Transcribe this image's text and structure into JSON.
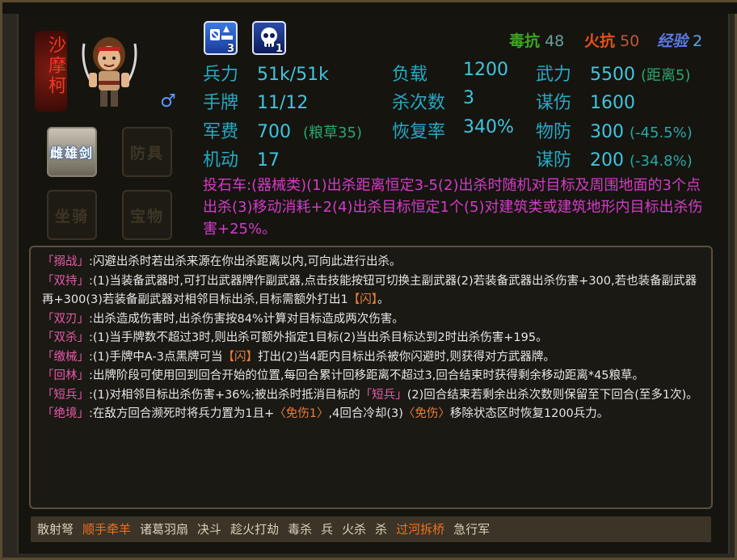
{
  "hero": {
    "name": "沙摩柯",
    "gender_icon": "male-gender-icon"
  },
  "equipment": {
    "weapon": "雌雄剑",
    "armor": "防具",
    "mount": "坐骑",
    "treasure": "宝物"
  },
  "status_icons": [
    {
      "icon": "status-effect-icon",
      "count": "3"
    },
    {
      "icon": "skull-icon",
      "count": "1"
    }
  ],
  "resists": {
    "poison_label": "毒抗",
    "poison_value": "48",
    "fire_label": "火抗",
    "fire_value": "50",
    "exp_label": "经验",
    "exp_value": "2"
  },
  "stats": {
    "troops_label": "兵力",
    "troops_value": "51k/51k",
    "hand_label": "手牌",
    "hand_value": "11/12",
    "funds_label": "军费",
    "funds_value": "700",
    "funds_note": "(粮草35)",
    "mobility_label": "机动",
    "mobility_value": "17",
    "load_label": "负载",
    "load_value": "1200",
    "kills_label": "杀次数",
    "kills_value": "3",
    "recovery_label": "恢复率",
    "recovery_value": "340%",
    "force_label": "武力",
    "force_value": "5500",
    "force_note": "(距离5)",
    "strategy_dmg_label": "谋伤",
    "strategy_dmg_value": "1600",
    "phys_def_label": "物防",
    "phys_def_value": "300",
    "phys_def_note": "(-45.5%)",
    "strategy_def_label": "谋防",
    "strategy_def_value": "200",
    "strategy_def_note": "(-34.8%)"
  },
  "catapult_text": "投石车:(器械类)(1)出杀距离恒定3-5(2)出杀时随机对目标及周围地面的3个点出杀(3)移动消耗+2(4)出杀目标恒定1个(5)对建筑类或建筑地形内目标出杀伤害+25%。",
  "skills": [
    {
      "name": "「搦战」",
      "parts": [
        {
          "t": ":闪避出杀时若出杀来源在你出杀距离以内,可向此进行出杀。"
        }
      ]
    },
    {
      "name": "「双持」",
      "parts": [
        {
          "t": ":(1)当装备武器时,可打出武器牌作副武器,点击技能按钮可切换主副武器(2)若装备武器出杀伤害+300,若也装备副武器再+300(3)若装备副武器对相邻目标出杀,目标需额外打出1"
        },
        {
          "t": "【闪】",
          "c": "tok"
        },
        {
          "t": "。"
        }
      ]
    },
    {
      "name": "「双刃」",
      "parts": [
        {
          "t": ":出杀造成伤害时,出杀伤害按84%计算对目标造成两次伤害。"
        }
      ]
    },
    {
      "name": "「双杀」",
      "parts": [
        {
          "t": ":(1)当手牌数不超过3时,则出杀可额外指定1目标(2)当出杀目标达到2时出杀伤害+195。"
        }
      ]
    },
    {
      "name": "「缴械」",
      "parts": [
        {
          "t": ":(1)手牌中A-3点黑牌可当"
        },
        {
          "t": "【闪】",
          "c": "tok"
        },
        {
          "t": "打出(2)当4距内目标出杀被你闪避时,则获得对方武器牌。"
        }
      ]
    },
    {
      "name": "「回林」",
      "parts": [
        {
          "t": ":出牌阶段可使用回到回合开始的位置,每回合累计回移距离不超过3,回合结束时获得剩余移动距离*45粮草。"
        }
      ]
    },
    {
      "name": "「短兵」",
      "parts": [
        {
          "t": ":(1)对相邻目标出杀伤害+36%;被出杀时抵消目标的"
        },
        {
          "t": "「短兵」",
          "c": "br"
        },
        {
          "t": "(2)回合结束若剩余出杀次数则保留至下回合(至多1次)。"
        }
      ]
    },
    {
      "name": "「绝境」",
      "parts": [
        {
          "t": ":在敌方回合濒死时将兵力置为1且+"
        },
        {
          "t": "〈免伤1〉",
          "c": "tok"
        },
        {
          "t": ",4回合冷却(3)"
        },
        {
          "t": "〈免伤〉",
          "c": "tok"
        },
        {
          "t": "移除状态区时恢复1200兵力。"
        }
      ]
    }
  ],
  "cards": [
    {
      "label": "散射弩",
      "hl": false
    },
    {
      "label": "顺手牵羊",
      "hl": true
    },
    {
      "label": "诸葛羽扇",
      "hl": false
    },
    {
      "label": "决斗",
      "hl": false
    },
    {
      "label": "趁火打劫",
      "hl": false
    },
    {
      "label": "毒杀",
      "hl": false
    },
    {
      "label": "兵",
      "hl": false
    },
    {
      "label": "火杀",
      "hl": false
    },
    {
      "label": "杀",
      "hl": false
    },
    {
      "label": "过河拆桥",
      "hl": true
    },
    {
      "label": "急行军",
      "hl": false
    }
  ]
}
